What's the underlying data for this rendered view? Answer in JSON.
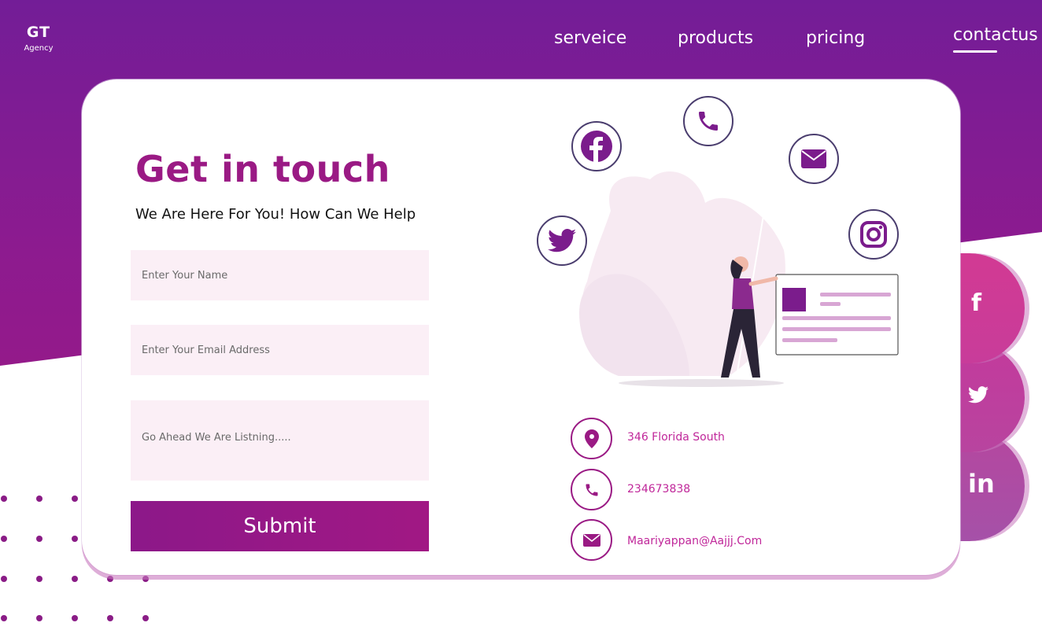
{
  "brand": {
    "name": "GT",
    "tagline": "Agency"
  },
  "nav": {
    "items": [
      {
        "label": "serveice"
      },
      {
        "label": "products"
      },
      {
        "label": "pricing"
      },
      {
        "label": "contactus",
        "active": true
      }
    ]
  },
  "contact_form": {
    "title": "Get in touch",
    "subtitle": "We Are Here For You! How Can We Help",
    "name_placeholder": "Enter Your Name",
    "email_placeholder": "Enter Your Email Address",
    "message_placeholder": "Go Ahead We Are Listning.....",
    "submit_label": "Submit"
  },
  "contact_info": {
    "address": "346 Florida South",
    "phone": "234673838",
    "email": "Maariyappan@Aajjj.Com"
  },
  "illustration_icons": [
    "facebook-icon",
    "phone-icon",
    "mail-icon",
    "twitter-icon",
    "instagram-icon"
  ],
  "side_social": [
    {
      "icon": "facebook-icon",
      "glyph": "f"
    },
    {
      "icon": "twitter-icon",
      "glyph": ""
    },
    {
      "icon": "linkedin-icon",
      "glyph": "in"
    }
  ],
  "colors": {
    "primary_purple": "#731d97",
    "accent_magenta": "#9a1a84",
    "link_pink": "#c0279a",
    "field_bg": "#fbeff6"
  }
}
